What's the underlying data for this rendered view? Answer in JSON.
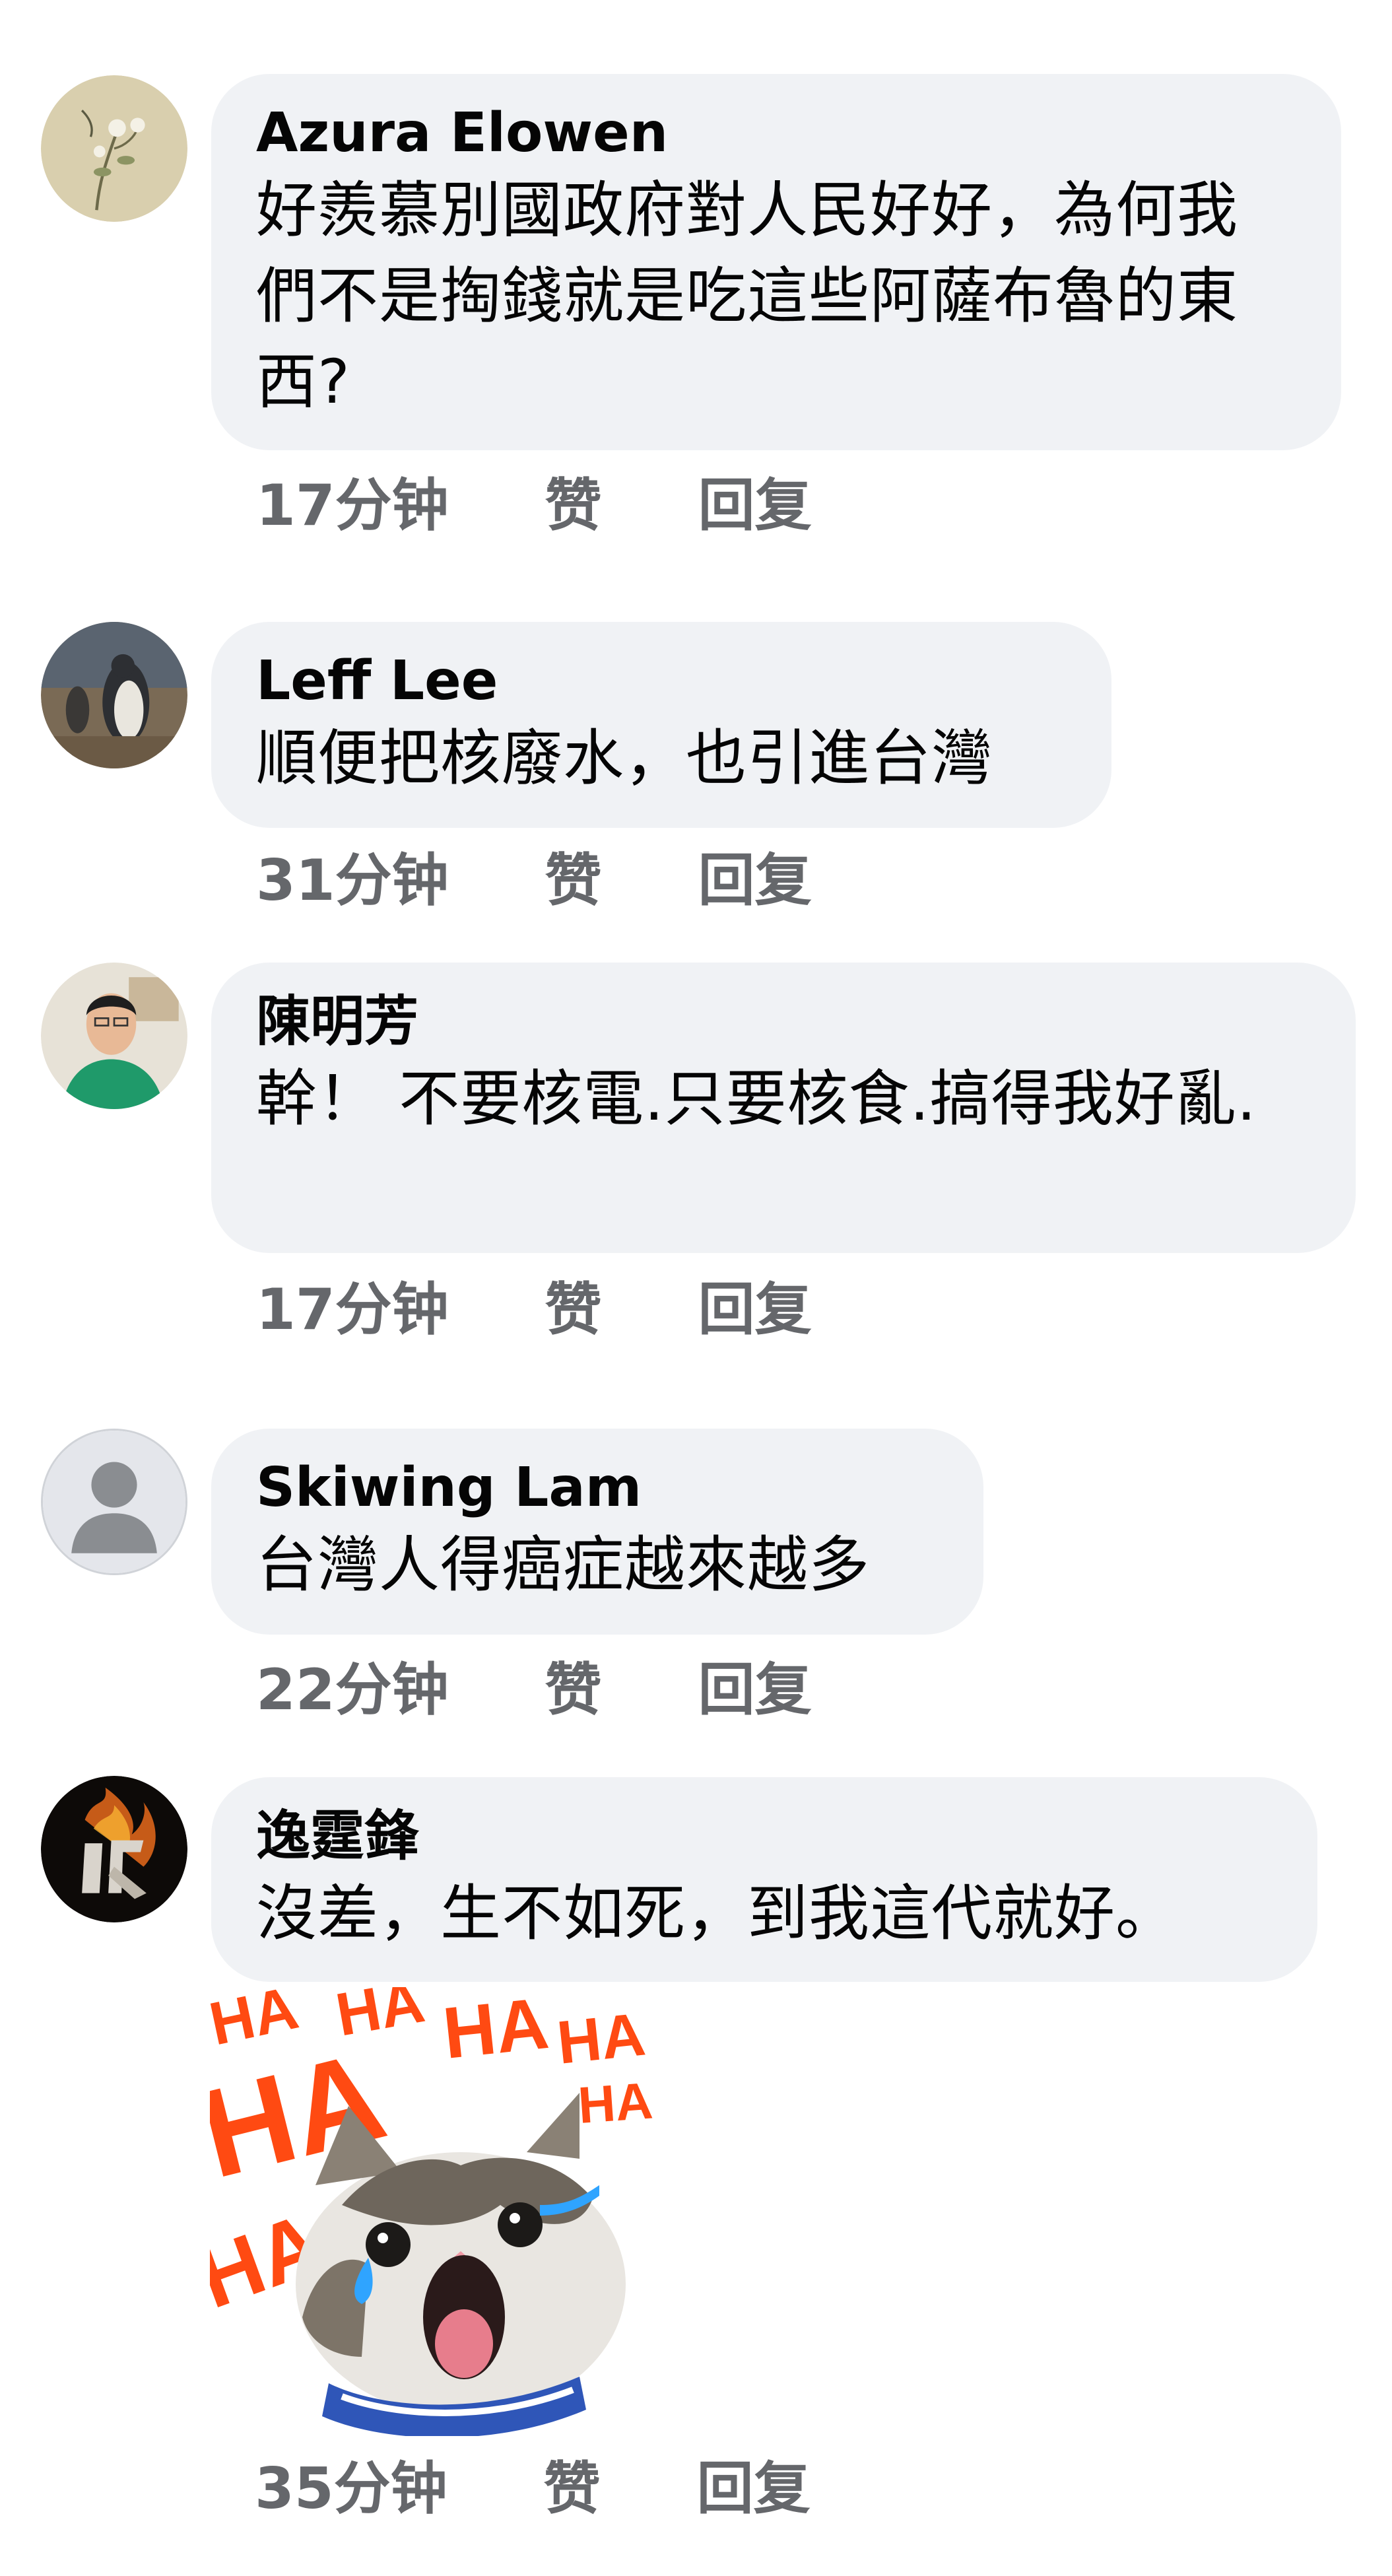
{
  "comments": [
    {
      "author": "Azura Elowen",
      "text": "好羨慕別國政府對人民好好，為何我們不是掏錢就是吃這些阿薩布魯的東西?",
      "time": "17分钟",
      "like_label": "赞",
      "reply_label": "回复"
    },
    {
      "author": "Leff Lee",
      "text": "順便把核廢水，也引進台灣",
      "time": "31分钟",
      "like_label": "赞",
      "reply_label": "回复"
    },
    {
      "author": "陳明芳",
      "text": "幹！ 不要核電.只要核食.搞得我好亂.",
      "time": "17分钟",
      "like_label": "赞",
      "reply_label": "回复"
    },
    {
      "author": "Skiwing Lam",
      "text": "台灣人得癌症越來越多",
      "time": "22分钟",
      "like_label": "赞",
      "reply_label": "回复"
    },
    {
      "author": "逸霆鋒",
      "text": "沒差，生不如死，到我這代就好。",
      "time": "35分钟",
      "like_label": "赞",
      "reply_label": "回复",
      "sticker": "laughing-crying-cat-sticker"
    }
  ],
  "sticker_text": "HA",
  "colors": {
    "bubble": "#f0f2f5",
    "meta": "#65676b",
    "text": "#050505",
    "sticker_ha": "#ff4a12"
  }
}
